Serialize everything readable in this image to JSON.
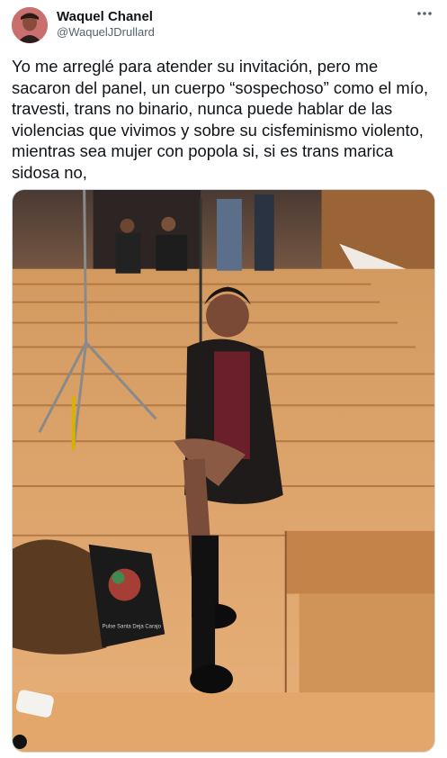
{
  "tweet": {
    "author": {
      "display_name": "Waquel Chanel",
      "handle": "@WaquelJDrullard"
    },
    "more_icon": "ellipsis-icon",
    "text": "Yo me arreglé para atender su invitación, pero me sacaron del panel, un cuerpo “sospechoso” como el mío, travesti, trans no binario, nunca puede hablar de las violencias que vivimos y sobre su cisfeminismo violento, mientras sea mujer con popola si, si es trans marica sidosa no,",
    "media": {
      "kind": "photo",
      "bag_print": "Pulse Santa Deja Carajo"
    }
  },
  "colors": {
    "text": "#0f1419",
    "secondary": "#536471",
    "border": "#cfd9de",
    "wood": "#c98a4e"
  }
}
